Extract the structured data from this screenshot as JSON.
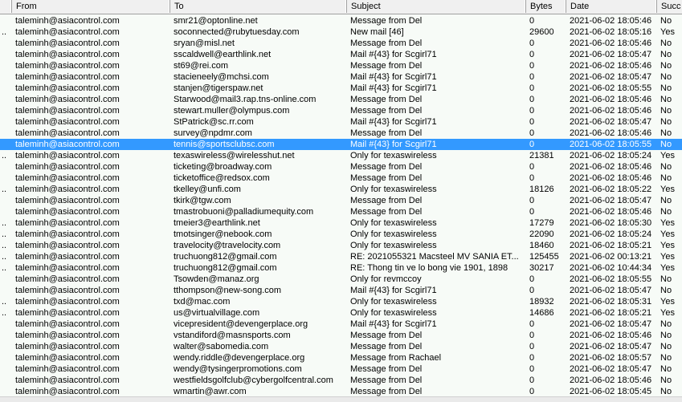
{
  "columns": {
    "marker": "",
    "from": "From",
    "to": "To",
    "subject": "Subject",
    "bytes": "Bytes",
    "date": "Date",
    "success": "Succ"
  },
  "selected_index": 11,
  "colors": {
    "selection": "#3399ff",
    "background": "#f7fbf7"
  },
  "rows": [
    {
      "m": "",
      "from": "taleminh@asiacontrol.com",
      "to": "smr21@optonline.net",
      "subject": "Message from Del",
      "bytes": "0",
      "date": "2021-06-02 18:05:46",
      "success": "No"
    },
    {
      "m": "..",
      "from": "taleminh@asiacontrol.com",
      "to": "soconnected@rubytuesday.com",
      "subject": "New mail [46]",
      "bytes": "29600",
      "date": "2021-06-02 18:05:16",
      "success": "Yes"
    },
    {
      "m": "",
      "from": "taleminh@asiacontrol.com",
      "to": "sryan@misl.net",
      "subject": "Message from Del",
      "bytes": "0",
      "date": "2021-06-02 18:05:46",
      "success": "No"
    },
    {
      "m": "",
      "from": "taleminh@asiacontrol.com",
      "to": "sscaldwell@earthlink.net",
      "subject": "Mail #{43} for Scgirl71",
      "bytes": "0",
      "date": "2021-06-02 18:05:47",
      "success": "No"
    },
    {
      "m": "",
      "from": "taleminh@asiacontrol.com",
      "to": "st69@rei.com",
      "subject": "Message from Del",
      "bytes": "0",
      "date": "2021-06-02 18:05:46",
      "success": "No"
    },
    {
      "m": "",
      "from": "taleminh@asiacontrol.com",
      "to": "stacieneely@mchsi.com",
      "subject": "Mail #{43} for Scgirl71",
      "bytes": "0",
      "date": "2021-06-02 18:05:47",
      "success": "No"
    },
    {
      "m": "",
      "from": "taleminh@asiacontrol.com",
      "to": "stanjen@tigerspaw.net",
      "subject": "Mail #{43} for Scgirl71",
      "bytes": "0",
      "date": "2021-06-02 18:05:55",
      "success": "No"
    },
    {
      "m": "",
      "from": "taleminh@asiacontrol.com",
      "to": "Starwood@mail3.rap.tns-online.com",
      "subject": "Message from Del",
      "bytes": "0",
      "date": "2021-06-02 18:05:46",
      "success": "No"
    },
    {
      "m": "",
      "from": "taleminh@asiacontrol.com",
      "to": "stewart.muller@olympus.com",
      "subject": "Message from Del",
      "bytes": "0",
      "date": "2021-06-02 18:05:46",
      "success": "No"
    },
    {
      "m": "",
      "from": "taleminh@asiacontrol.com",
      "to": "StPatrick@sc.rr.com",
      "subject": "Mail #{43} for Scgirl71",
      "bytes": "0",
      "date": "2021-06-02 18:05:47",
      "success": "No"
    },
    {
      "m": "",
      "from": "taleminh@asiacontrol.com",
      "to": "survey@npdmr.com",
      "subject": "Message from Del",
      "bytes": "0",
      "date": "2021-06-02 18:05:46",
      "success": "No"
    },
    {
      "m": "",
      "from": "taleminh@asiacontrol.com",
      "to": "tennis@sportsclubsc.com",
      "subject": "Mail #{43} for Scgirl71",
      "bytes": "0",
      "date": "2021-06-02 18:05:55",
      "success": "No"
    },
    {
      "m": "..",
      "from": "taleminh@asiacontrol.com",
      "to": "texaswireless@wirelesshut.net",
      "subject": "Only for texaswireless",
      "bytes": "21381",
      "date": "2021-06-02 18:05:24",
      "success": "Yes"
    },
    {
      "m": "",
      "from": "taleminh@asiacontrol.com",
      "to": "ticketing@broadway.com",
      "subject": "Message from Del",
      "bytes": "0",
      "date": "2021-06-02 18:05:46",
      "success": "No"
    },
    {
      "m": "",
      "from": "taleminh@asiacontrol.com",
      "to": "ticketoffice@redsox.com",
      "subject": "Message from Del",
      "bytes": "0",
      "date": "2021-06-02 18:05:46",
      "success": "No"
    },
    {
      "m": "..",
      "from": "taleminh@asiacontrol.com",
      "to": "tkelley@unfi.com",
      "subject": "Only for texaswireless",
      "bytes": "18126",
      "date": "2021-06-02 18:05:22",
      "success": "Yes"
    },
    {
      "m": "",
      "from": "taleminh@asiacontrol.com",
      "to": "tkirk@tgw.com",
      "subject": "Message from Del",
      "bytes": "0",
      "date": "2021-06-02 18:05:47",
      "success": "No"
    },
    {
      "m": "",
      "from": "taleminh@asiacontrol.com",
      "to": "tmastrobuoni@palladiumequity.com",
      "subject": "Message from Del",
      "bytes": "0",
      "date": "2021-06-02 18:05:46",
      "success": "No"
    },
    {
      "m": "..",
      "from": "taleminh@asiacontrol.com",
      "to": "tmeier3@earthlink.net",
      "subject": "Only for texaswireless",
      "bytes": "17279",
      "date": "2021-06-02 18:05:30",
      "success": "Yes"
    },
    {
      "m": "..",
      "from": "taleminh@asiacontrol.com",
      "to": "tmotsinger@nebook.com",
      "subject": "Only for texaswireless",
      "bytes": "22090",
      "date": "2021-06-02 18:05:24",
      "success": "Yes"
    },
    {
      "m": "..",
      "from": "taleminh@asiacontrol.com",
      "to": "travelocity@travelocity.com",
      "subject": "Only for texaswireless",
      "bytes": "18460",
      "date": "2021-06-02 18:05:21",
      "success": "Yes"
    },
    {
      "m": "..",
      "from": "taleminh@asiacontrol.com",
      "to": "truchuong812@gmail.com",
      "subject": "RE: 2021055321 Macsteel MV SANIA ET...",
      "bytes": "125455",
      "date": "2021-06-02 00:13:21",
      "success": "Yes"
    },
    {
      "m": "..",
      "from": "taleminh@asiacontrol.com",
      "to": "truchuong812@gmail.com",
      "subject": "RE: Thong tin ve lo bong vie 1901, 1898",
      "bytes": "30217",
      "date": "2021-06-02 10:44:34",
      "success": "Yes"
    },
    {
      "m": "",
      "from": "taleminh@asiacontrol.com",
      "to": "Tsowden@manaz.org",
      "subject": "Only for revmccoy",
      "bytes": "0",
      "date": "2021-06-02 18:05:55",
      "success": "No"
    },
    {
      "m": "",
      "from": "taleminh@asiacontrol.com",
      "to": "tthompson@new-song.com",
      "subject": "Mail #{43} for Scgirl71",
      "bytes": "0",
      "date": "2021-06-02 18:05:47",
      "success": "No"
    },
    {
      "m": "..",
      "from": "taleminh@asiacontrol.com",
      "to": "txd@mac.com",
      "subject": "Only for texaswireless",
      "bytes": "18932",
      "date": "2021-06-02 18:05:31",
      "success": "Yes"
    },
    {
      "m": "..",
      "from": "taleminh@asiacontrol.com",
      "to": "us@virtualvillage.com",
      "subject": "Only for texaswireless",
      "bytes": "14686",
      "date": "2021-06-02 18:05:21",
      "success": "Yes"
    },
    {
      "m": "",
      "from": "taleminh@asiacontrol.com",
      "to": "vicepresident@devengerplace.org",
      "subject": "Mail #{43} for Scgirl71",
      "bytes": "0",
      "date": "2021-06-02 18:05:47",
      "success": "No"
    },
    {
      "m": "",
      "from": "taleminh@asiacontrol.com",
      "to": "vstandiford@masnsports.com",
      "subject": "Message from Del",
      "bytes": "0",
      "date": "2021-06-02 18:05:46",
      "success": "No"
    },
    {
      "m": "",
      "from": "taleminh@asiacontrol.com",
      "to": "walter@sabomedia.com",
      "subject": "Message from Del",
      "bytes": "0",
      "date": "2021-06-02 18:05:47",
      "success": "No"
    },
    {
      "m": "",
      "from": "taleminh@asiacontrol.com",
      "to": "wendy.riddle@devengerplace.org",
      "subject": "Message from Rachael",
      "bytes": "0",
      "date": "2021-06-02 18:05:57",
      "success": "No"
    },
    {
      "m": "",
      "from": "taleminh@asiacontrol.com",
      "to": "wendy@tysingerpromotions.com",
      "subject": "Message from Del",
      "bytes": "0",
      "date": "2021-06-02 18:05:47",
      "success": "No"
    },
    {
      "m": "",
      "from": "taleminh@asiacontrol.com",
      "to": "westfieldsgolfclub@cybergolfcentral.com",
      "subject": "Message from Del",
      "bytes": "0",
      "date": "2021-06-02 18:05:46",
      "success": "No"
    },
    {
      "m": "",
      "from": "taleminh@asiacontrol.com",
      "to": "wmartin@awr.com",
      "subject": "Message from Del",
      "bytes": "0",
      "date": "2021-06-02 18:05:45",
      "success": "No"
    }
  ]
}
